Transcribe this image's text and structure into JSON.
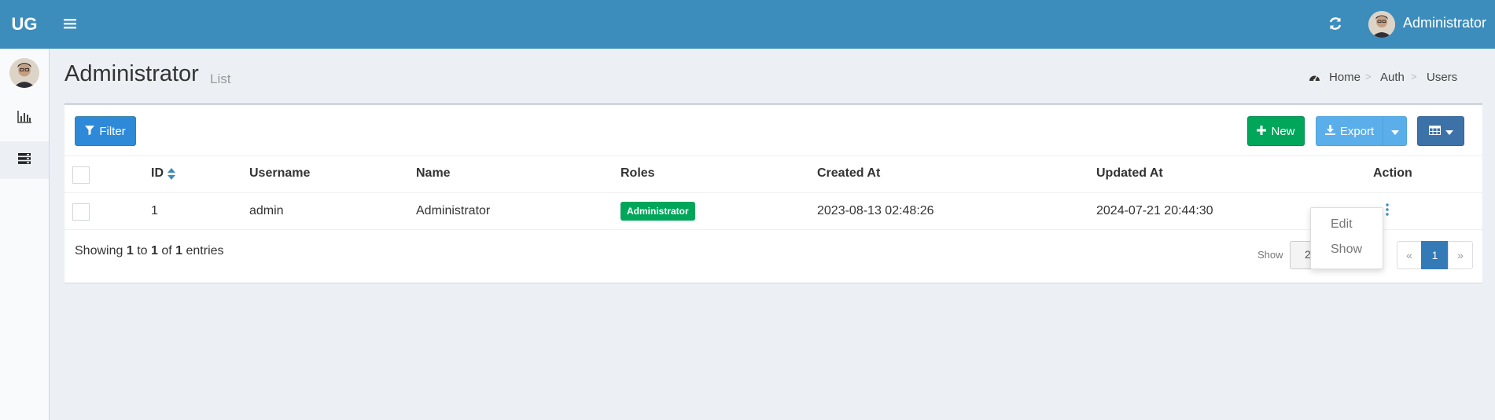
{
  "header": {
    "logo": "UG",
    "user_name": "Administrator",
    "icons": {
      "menu": "hamburger-icon",
      "refresh": "refresh-icon"
    }
  },
  "sidebar": {
    "items": [
      {
        "icon": "bar-chart-icon"
      },
      {
        "icon": "server-icon",
        "active": true
      }
    ]
  },
  "page": {
    "title": "Administrator",
    "subtitle": "List",
    "breadcrumb": [
      "Home",
      "Auth",
      "Users"
    ]
  },
  "toolbar": {
    "filter_label": "Filter",
    "new_label": "New",
    "export_label": "Export"
  },
  "table": {
    "headers": [
      "ID",
      "Username",
      "Name",
      "Roles",
      "Created At",
      "Updated At",
      "Action"
    ],
    "rows": [
      {
        "id": "1",
        "username": "admin",
        "name": "Administrator",
        "role": "Administrator",
        "created_at": "2023-08-13 02:48:26",
        "updated_at": "2024-07-21 20:44:30"
      }
    ]
  },
  "footer": {
    "showing_prefix": "Showing",
    "from": "1",
    "to_word": "to",
    "to": "1",
    "of_word": "of",
    "total": "1",
    "entries_word": "entries",
    "show_label": "Show",
    "per_page_partial": "2",
    "entries_tail": "s",
    "pagination": {
      "prev": "«",
      "current": "1",
      "next": "»"
    }
  },
  "action_menu": {
    "items": [
      "Edit",
      "Show"
    ]
  },
  "colors": {
    "header": "#3c8dbc",
    "success": "#00a65a",
    "primary": "#337ab7"
  }
}
